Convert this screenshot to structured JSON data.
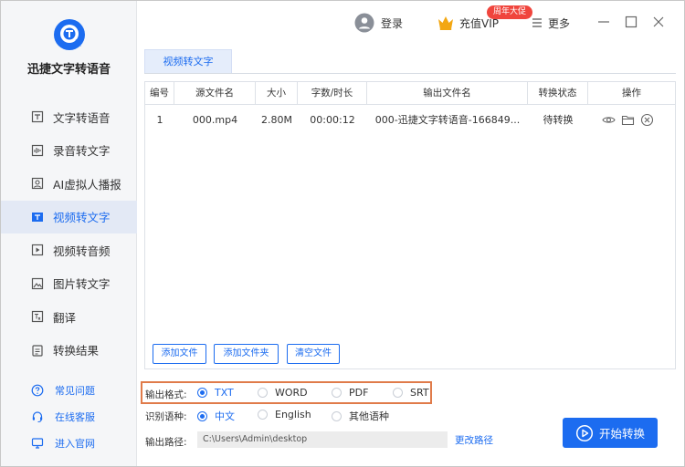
{
  "app": {
    "name": "迅捷文字转语音"
  },
  "sidebar": {
    "items": [
      {
        "label": "文字转语音"
      },
      {
        "label": "录音转文字"
      },
      {
        "label": "AI虚拟人播报"
      },
      {
        "label": "视频转文字",
        "active": true
      },
      {
        "label": "视频转音频"
      },
      {
        "label": "图片转文字"
      },
      {
        "label": "翻译"
      },
      {
        "label": "转换结果"
      }
    ],
    "bottom": [
      {
        "label": "常见问题"
      },
      {
        "label": "在线客服"
      },
      {
        "label": "进入官网"
      }
    ]
  },
  "header": {
    "login": "登录",
    "vip": "充值VIP",
    "vip_badge": "周年大促",
    "more": "更多"
  },
  "tab": {
    "label": "视频转文字"
  },
  "table": {
    "columns": [
      "编号",
      "源文件名",
      "大小",
      "字数/时长",
      "输出文件名",
      "转换状态",
      "操作"
    ],
    "rows": [
      {
        "id": "1",
        "source": "000.mp4",
        "size": "2.80M",
        "duration": "00:00:12",
        "output": "000-迅捷文字转语音-166849...",
        "status": "待转换"
      }
    ],
    "buttons": {
      "add_file": "添加文件",
      "add_folder": "添加文件夹",
      "clear": "清空文件"
    }
  },
  "options": {
    "format_label": "输出格式:",
    "formats": [
      "TXT",
      "WORD",
      "PDF",
      "SRT"
    ],
    "format_selected": "TXT",
    "lang_label": "识别语种:",
    "langs": [
      "中文",
      "English",
      "其他语种"
    ],
    "lang_selected": "中文",
    "path_label": "输出路径:",
    "path_value": "C:\\Users\\Admin\\desktop",
    "change_path": "更改路径"
  },
  "start_button": "开始转换",
  "colors": {
    "accent": "#1c6cf0",
    "highlight_border": "#e07b4a",
    "badge": "#f0453d"
  }
}
